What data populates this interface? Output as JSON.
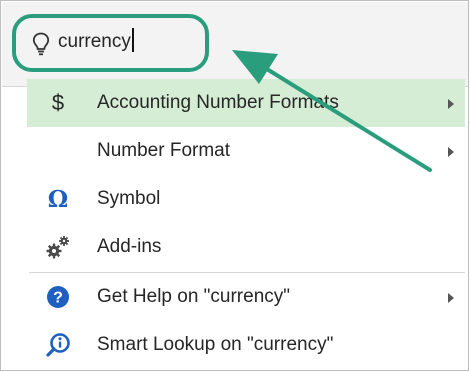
{
  "search": {
    "query": "currency",
    "icon": "lightbulb-icon"
  },
  "menu": {
    "items": [
      {
        "label": "Accounting Number Formats",
        "icon": "dollar-icon",
        "glyph": "$",
        "submenu": true,
        "highlighted": true
      },
      {
        "label": "Number Format",
        "icon": "none",
        "submenu": true
      },
      {
        "label": "Symbol",
        "icon": "omega-icon",
        "glyph": "Ω",
        "submenu": false
      },
      {
        "label": "Add-ins",
        "icon": "gears-icon",
        "submenu": false
      },
      {
        "label": "Get Help on \"currency\"",
        "icon": "help-icon",
        "glyph": "?",
        "submenu": true
      },
      {
        "label": "Smart Lookup on \"currency\"",
        "icon": "smart-lookup-icon",
        "submenu": false
      }
    ]
  },
  "colors": {
    "annotation": "#2a9d7c",
    "highlight_row": "#d5ecd5",
    "icon_blue": "#1f5fbf"
  }
}
